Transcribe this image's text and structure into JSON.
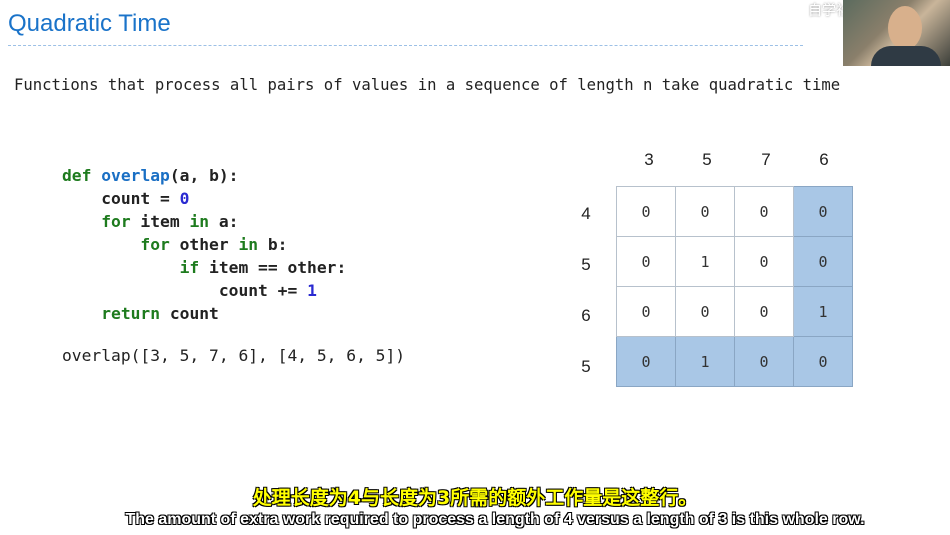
{
  "slide": {
    "title": "Quadratic Time",
    "statement": "Functions that process all pairs of values in a sequence of length n take quadratic time"
  },
  "watermark": "自学社区",
  "code": {
    "line1_kw": "def",
    "line1_fn": "overlap",
    "line1_rest": "(a, b):",
    "line2_a": "    count = ",
    "line2_num": "0",
    "line3_kw": "    for",
    "line3_rest": " item ",
    "line3_in": "in",
    "line3_rest2": " a:",
    "line4_kw": "        for",
    "line4_rest": " other ",
    "line4_in": "in",
    "line4_rest2": " b:",
    "line5_kw": "            if",
    "line5_rest": " item == other:",
    "line6_a": "                count += ",
    "line6_num": "1",
    "line7_kw": "    return",
    "line7_rest": " count",
    "call": "overlap([3, 5, 7, 6], [4, 5, 6, 5])"
  },
  "grid": {
    "column_headers": [
      "3",
      "5",
      "7",
      "6"
    ],
    "row_headers": [
      "4",
      "5",
      "6",
      "5"
    ],
    "cells": [
      [
        "0",
        "0",
        "0",
        "0"
      ],
      [
        "0",
        "1",
        "0",
        "0"
      ],
      [
        "0",
        "0",
        "0",
        "1"
      ],
      [
        "0",
        "1",
        "0",
        "0"
      ]
    ],
    "highlight_color": "#a9c7e6"
  },
  "subtitles": {
    "chinese": "处理长度为4与长度为3所需的额外工作量是这整行。",
    "english": "The amount of extra work required to process a length of 4 versus a length of 3 is this whole row."
  }
}
